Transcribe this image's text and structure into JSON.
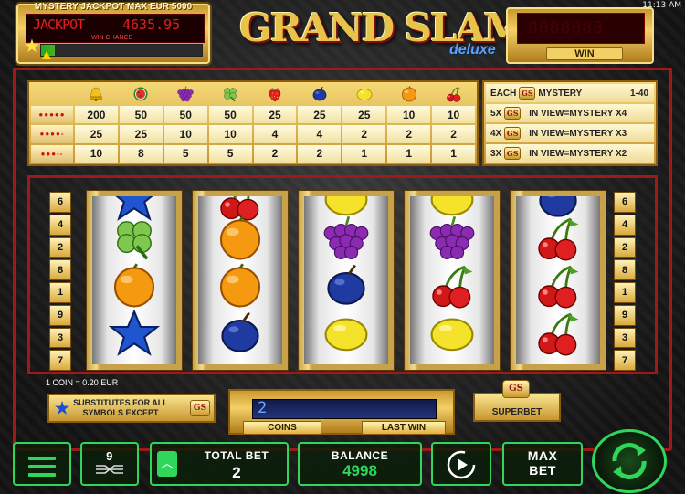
{
  "clock": "11:13 AM",
  "jackpot": {
    "title": "MYSTERY JACKPOT MAX EUR 5000",
    "label": "JACKPOT",
    "value": "4635.95",
    "win_chance": "WIN CHANCE"
  },
  "logo": {
    "main": "GRAND SLAM",
    "sub": "deluxe"
  },
  "win": {
    "label": "WIN",
    "digits": "8888888"
  },
  "paytable": {
    "symbols": [
      "bell",
      "watermelon",
      "grapes",
      "clover",
      "strawberry",
      "plum",
      "lemon",
      "orange",
      "cherry"
    ],
    "rows": [
      {
        "dots": "●●●●●",
        "values": [
          "200",
          "50",
          "50",
          "50",
          "25",
          "25",
          "25",
          "10",
          "10"
        ]
      },
      {
        "dots": "●●●●-",
        "values": [
          "25",
          "25",
          "10",
          "10",
          "4",
          "4",
          "2",
          "2",
          "2"
        ]
      },
      {
        "dots": "●●●--",
        "values": [
          "10",
          "8",
          "5",
          "5",
          "2",
          "2",
          "1",
          "1",
          "1"
        ]
      }
    ]
  },
  "mystery": {
    "each_prefix": "EACH",
    "each_suffix": "MYSTERY",
    "each_range": "1-40",
    "gs": "GS",
    "rows": [
      {
        "count": "5X",
        "text": "IN VIEW=MYSTERY X4"
      },
      {
        "count": "4X",
        "text": "IN VIEW=MYSTERY X3"
      },
      {
        "count": "3X",
        "text": "IN VIEW=MYSTERY X2"
      }
    ]
  },
  "side_numbers": [
    "6",
    "4",
    "2",
    "8",
    "1",
    "9",
    "3",
    "7"
  ],
  "reels": [
    [
      "star",
      "clover",
      "orange",
      "star"
    ],
    [
      "cherry",
      "orange",
      "orange",
      "plum"
    ],
    [
      "lemon",
      "grapes",
      "plum",
      "lemon"
    ],
    [
      "lemon",
      "grapes",
      "cherry",
      "lemon"
    ],
    [
      "plum",
      "cherry",
      "cherry",
      "cherry"
    ]
  ],
  "coin_info": "1 COIN = 0.20 EUR",
  "substitutes": {
    "line1": "SUBSTITUTES FOR ALL",
    "line2": "SYMBOLS EXCEPT"
  },
  "coins": {
    "label": "COINS",
    "value": "2"
  },
  "last_win": {
    "label": "LAST WIN"
  },
  "superbet": {
    "label": "SUPERBET",
    "gs": "GS"
  },
  "controls": {
    "lines": "9",
    "total_bet_label": "TOTAL BET",
    "total_bet_value": "2",
    "balance_label": "BALANCE",
    "balance_value": "4998",
    "max_bet_line1": "MAX",
    "max_bet_line2": "BET"
  },
  "colors": {
    "accent_green": "#2fd65a",
    "frame_red": "#a01818",
    "gold": "#e8c34a"
  }
}
